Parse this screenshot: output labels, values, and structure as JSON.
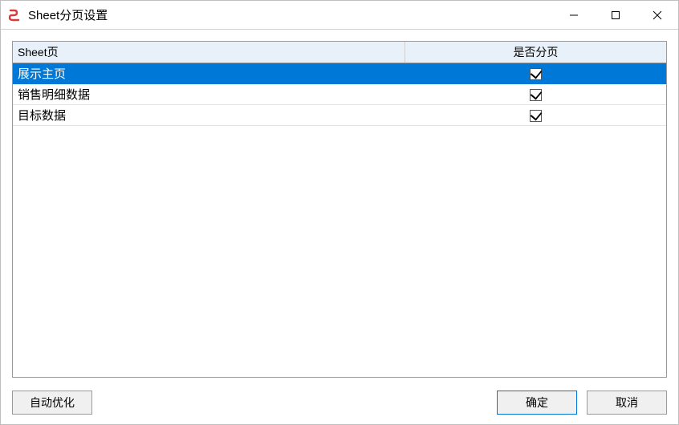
{
  "window": {
    "title": "Sheet分页设置"
  },
  "table": {
    "headers": {
      "sheet": "Sheet页",
      "paginate": "是否分页"
    },
    "rows": [
      {
        "label": "展示主页",
        "checked": true,
        "selected": true
      },
      {
        "label": "销售明细数据",
        "checked": true,
        "selected": false
      },
      {
        "label": "目标数据",
        "checked": true,
        "selected": false
      }
    ]
  },
  "buttons": {
    "auto_optimize": "自动优化",
    "ok": "确定",
    "cancel": "取消"
  }
}
